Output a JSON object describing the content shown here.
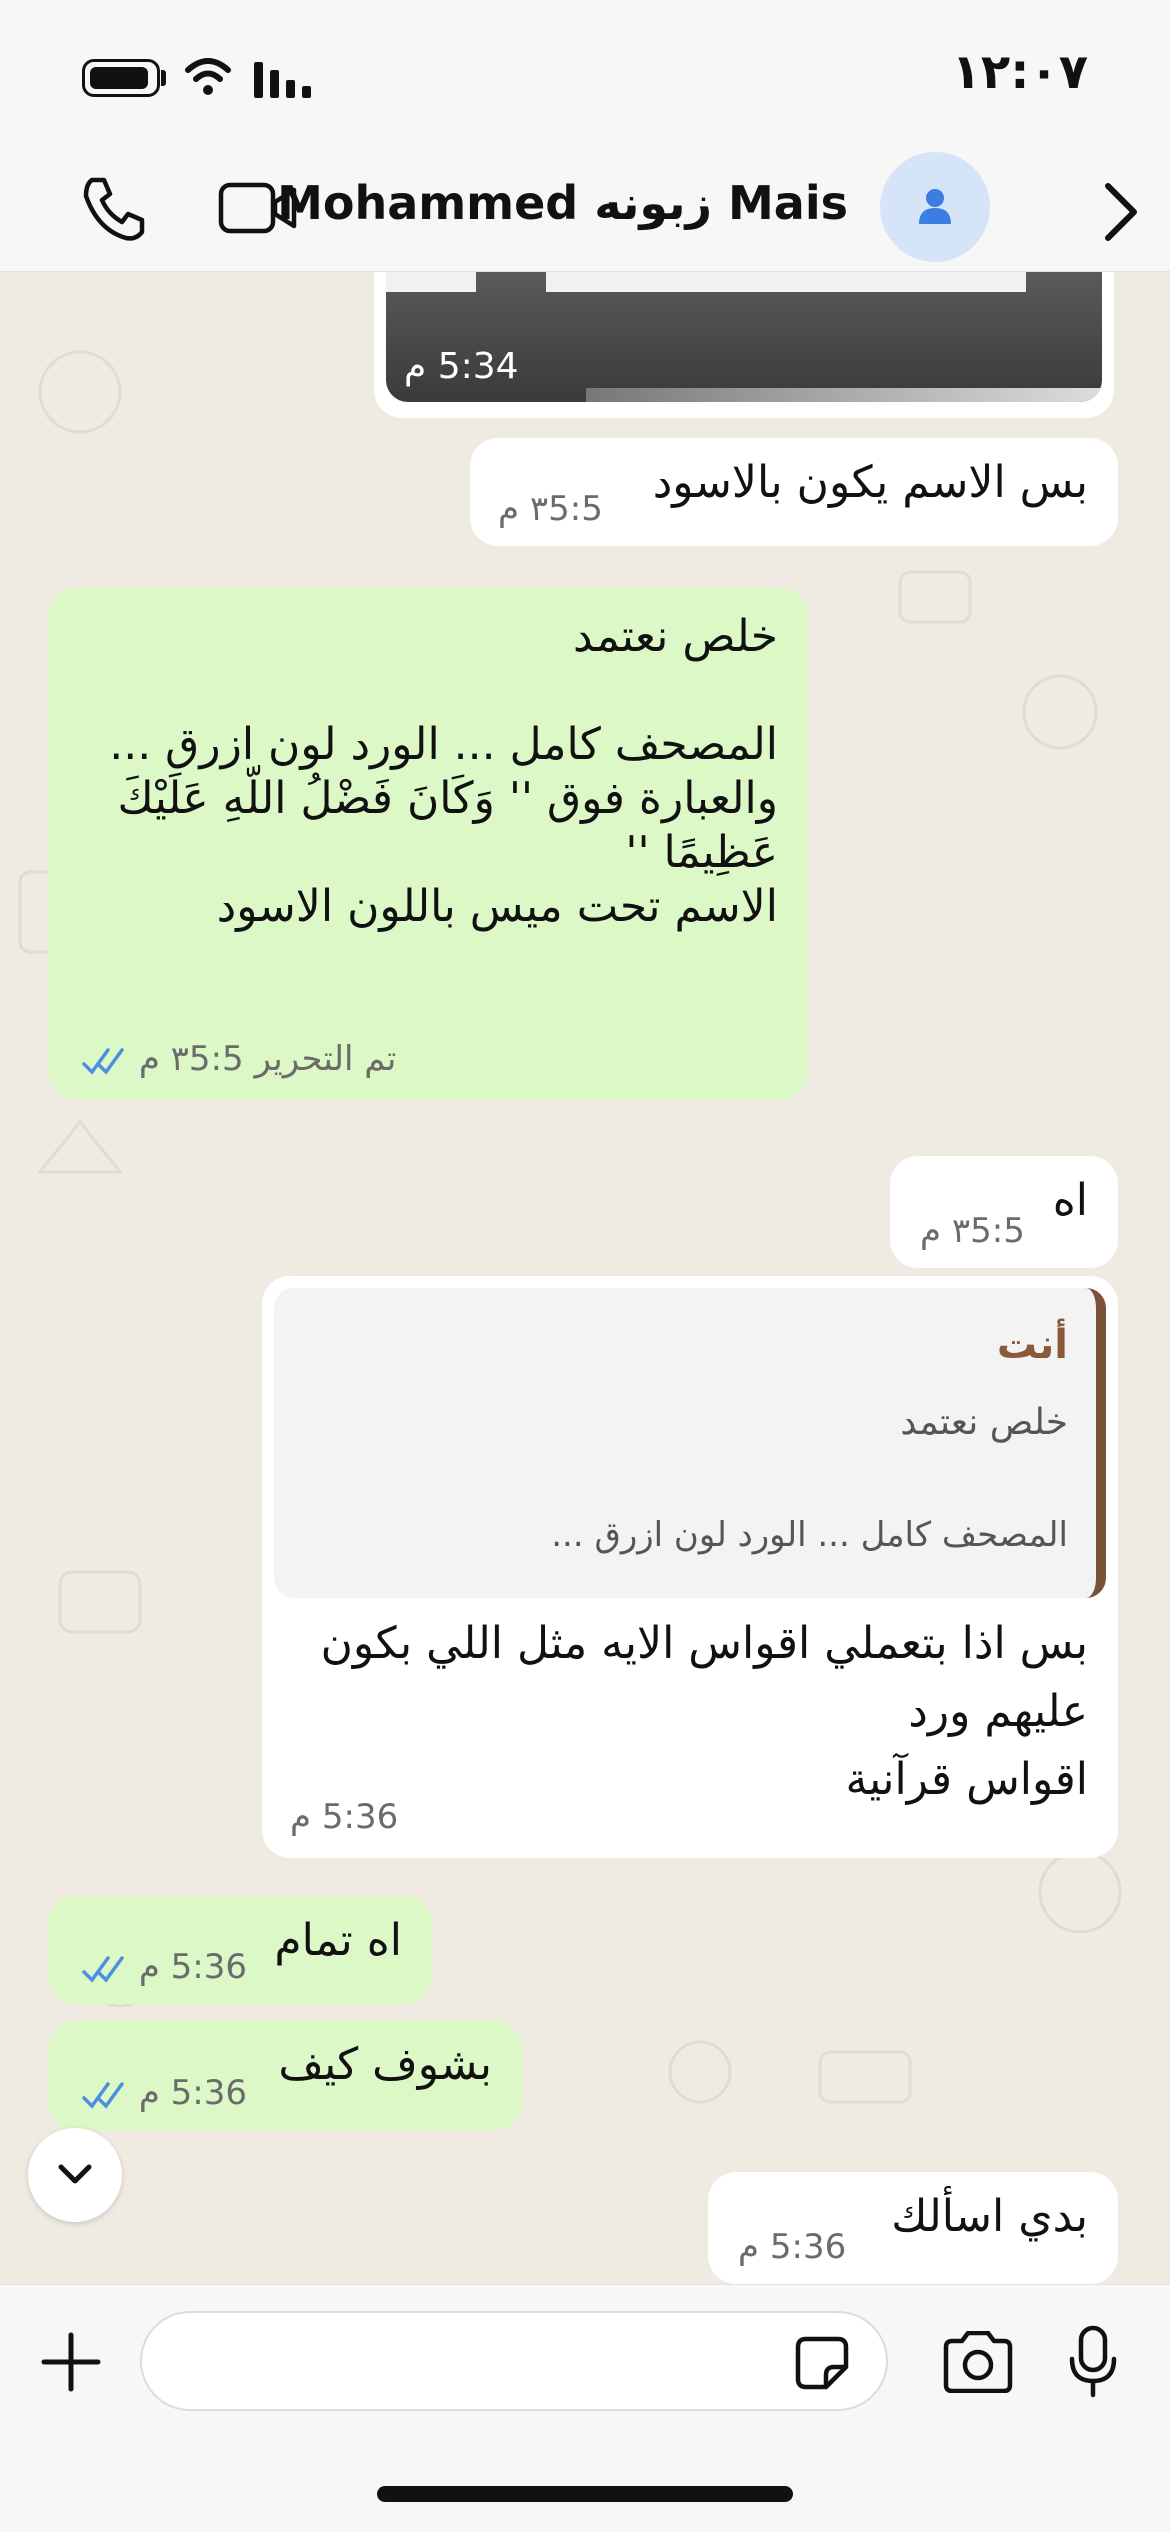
{
  "status_bar": {
    "time": "١٢:٠٧"
  },
  "header": {
    "contact_name": "Mohammed زبونه Mais"
  },
  "messages": [
    {
      "type": "media",
      "direction": "in",
      "time": "5:34 م"
    },
    {
      "direction": "in",
      "text": "بس الاسم يكون بالاسود",
      "time": "٣5:5 م"
    },
    {
      "direction": "out",
      "lines": [
        "خلص نعتمد",
        "",
        "المصحف كامل ... الورد لون ازرق ...",
        "والعبارة فوق '' وَكَانَ فَضْلُ اللّهِ عَلَيْكَ",
        "عَظِيمًا ''",
        "الاسم تحت ميس باللون الاسود"
      ],
      "edited": "تم التحرير",
      "time": "٣5:5 م"
    },
    {
      "direction": "in",
      "text": "اه",
      "time": "٣5:5 م"
    },
    {
      "direction": "in",
      "quote": {
        "author": "أنت",
        "line1": "خلص نعتمد",
        "line2": "المصحف كامل ... الورد لون ازرق ..."
      },
      "lines": [
        "بس اذا بتعملي اقواس الايه مثل اللي بكون",
        "عليهم ورد",
        "اقواس قرآنية"
      ],
      "time": "5:36 م"
    },
    {
      "direction": "out",
      "text": "اه تمام",
      "time": "5:36 م"
    },
    {
      "direction": "out",
      "text": "بشوف كيف",
      "time": "5:36 م"
    },
    {
      "direction": "in",
      "text": "بدي اسألك",
      "time": "5:36 م"
    }
  ],
  "colors": {
    "incoming": "#ffffff",
    "outgoing": "#dcf8c6",
    "read_ticks": "#4a90e2",
    "quote_bar": "#7a5236"
  }
}
